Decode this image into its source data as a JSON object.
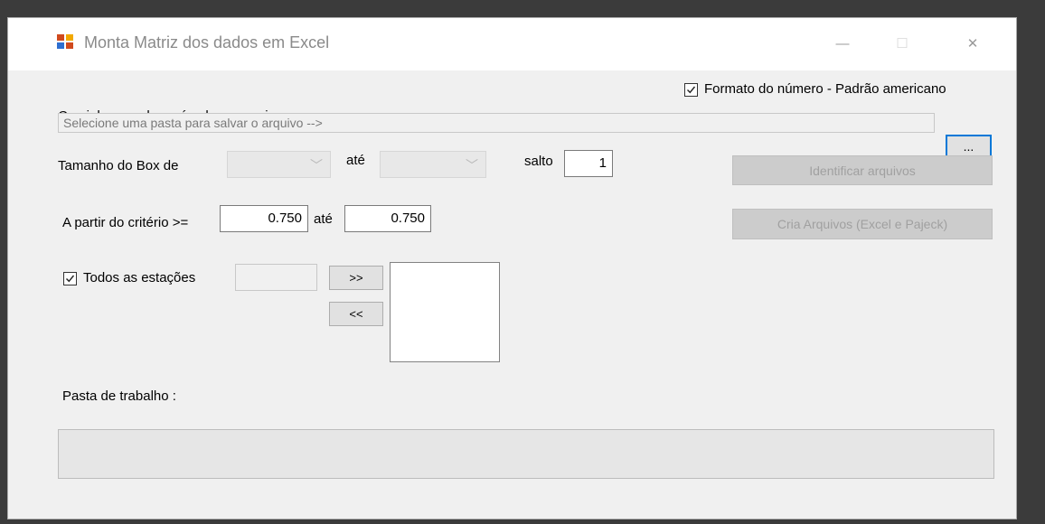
{
  "window": {
    "title": "Monta Matriz dos dados em Excel",
    "controls": {
      "minimize": "—",
      "maximize": "☐",
      "close": "✕"
    }
  },
  "path": {
    "label": "Caminho a onde será salvo o arquivo",
    "placeholder": "Selecione uma pasta para salvar o arquivo  -->",
    "browse_label": "..."
  },
  "format": {
    "label": "Formato do número - Padrão americano",
    "checked": true
  },
  "box": {
    "label": "Tamanho do Box de",
    "to_label": "até",
    "step_label": "salto",
    "step_value": "1"
  },
  "criteria": {
    "label": "A partir do critério >=",
    "from_value": "0.750",
    "to_label": "até",
    "to_value": "0.750"
  },
  "buttons": {
    "identify": "Identificar arquivos",
    "create": "Cria Arquivos (Excel e Pajeck)"
  },
  "stations": {
    "label": "Todos as estações",
    "checked": true,
    "add_label": ">>",
    "remove_label": "<<"
  },
  "workbook": {
    "label": "Pasta de trabalho :"
  }
}
